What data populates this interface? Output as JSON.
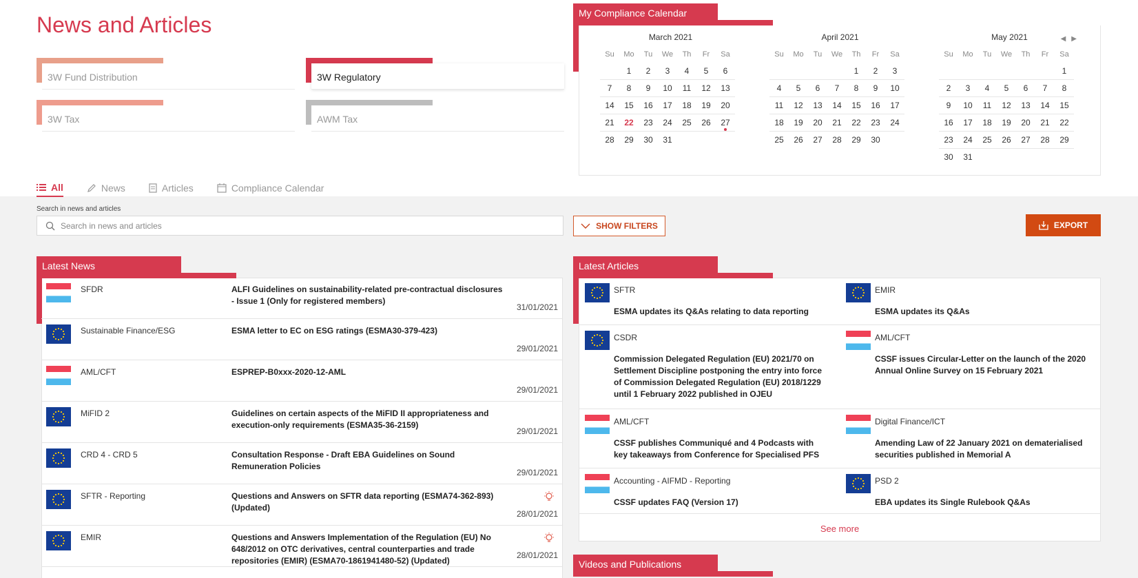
{
  "page": {
    "title": "News and Articles"
  },
  "categories": [
    {
      "label": "3W Fund Distribution",
      "color": "#e8a08a"
    },
    {
      "label": "3W Regulatory",
      "color": "#d63a4f"
    },
    {
      "label": "3W Tax",
      "color": "#ee9c8d"
    },
    {
      "label": "AWM Tax",
      "color": "#bdbdbd"
    }
  ],
  "tabs": [
    {
      "label": "All",
      "icon": "list-icon",
      "active": true
    },
    {
      "label": "News",
      "icon": "pencil-icon"
    },
    {
      "label": "Articles",
      "icon": "document-icon"
    },
    {
      "label": "Compliance Calendar",
      "icon": "calendar-icon"
    }
  ],
  "calendar": {
    "title": "My Compliance Calendar",
    "dow": [
      "Su",
      "Mo",
      "Tu",
      "We",
      "Th",
      "Fr",
      "Sa"
    ],
    "months": [
      {
        "name": "March 2021",
        "start": 1,
        "days": 31,
        "today": 22,
        "marked": [
          27
        ]
      },
      {
        "name": "April 2021",
        "start": 4,
        "days": 30,
        "today": null,
        "marked": []
      },
      {
        "name": "May 2021",
        "start": 6,
        "days": 31,
        "today": null,
        "marked": []
      }
    ]
  },
  "search": {
    "label": "Search in news and articles",
    "placeholder": "Search in news and articles"
  },
  "buttons": {
    "filters": "SHOW FILTERS",
    "export": "EXPORT"
  },
  "latest_news": {
    "title": "Latest News",
    "items": [
      {
        "flag": "lu",
        "category": "SFDR",
        "title": "ALFI Guidelines on sustainability-related pre-contractual disclosures - Issue 1 (Only for registered members)",
        "date": "31/01/2021",
        "bulb": false
      },
      {
        "flag": "eu",
        "category": "Sustainable Finance/ESG",
        "title": "ESMA letter to EC on ESG ratings (ESMA30-379-423)",
        "date": "29/01/2021",
        "bulb": false
      },
      {
        "flag": "lu",
        "category": "AML/CFT",
        "title": "ESPREP-B0xxx-2020-12-AML",
        "date": "29/01/2021",
        "bulb": false
      },
      {
        "flag": "eu",
        "category": "MiFID 2",
        "title": "Guidelines on certain aspects of the MiFID II appropriateness and execution-only requirements (ESMA35-36-2159)",
        "date": "29/01/2021",
        "bulb": false
      },
      {
        "flag": "eu",
        "category": "CRD 4 - CRD 5",
        "title": "Consultation Response - Draft EBA Guidelines on Sound Remuneration Policies",
        "date": "29/01/2021",
        "bulb": false
      },
      {
        "flag": "eu",
        "category": "SFTR - Reporting",
        "title": "Questions and Answers on SFTR data reporting (ESMA74-362-893) (Updated)",
        "date": "28/01/2021",
        "bulb": true
      },
      {
        "flag": "eu",
        "category": "EMIR",
        "title": "Questions and Answers Implementation of the Regulation (EU) No 648/2012 on OTC derivatives, central counterparties and trade repositories (EMIR) (ESMA70-1861941480-52) (Updated)",
        "date": "28/01/2021",
        "bulb": true
      }
    ]
  },
  "latest_articles": {
    "title": "Latest Articles",
    "see_more": "See more",
    "items": [
      {
        "flag": "eu",
        "category": "SFTR",
        "title": "ESMA updates its Q&As relating to data reporting"
      },
      {
        "flag": "eu",
        "category": "EMIR",
        "title": "ESMA updates its Q&As"
      },
      {
        "flag": "eu",
        "category": "CSDR",
        "title": "Commission Delegated Regulation (EU) 2021/70 on Settlement Discipline postponing the entry into force of Commission Delegated Regulation (EU) 2018/1229 until 1 February 2022 published in OJEU"
      },
      {
        "flag": "lu",
        "category": "AML/CFT",
        "title": "CSSF issues Circular-Letter on the launch of the 2020 Annual Online Survey on 15 February 2021"
      },
      {
        "flag": "lu",
        "category": "AML/CFT",
        "title": "CSSF publishes Communiqué and 4 Podcasts with key takeaways from Conference for Specialised PFS"
      },
      {
        "flag": "lu",
        "category": "Digital Finance/ICT",
        "title": "Amending Law of 22 January 2021 on dematerialised securities published in Memorial A"
      },
      {
        "flag": "lu",
        "category": "Accounting - AIFMD - Reporting",
        "title": "CSSF updates FAQ (Version 17)"
      },
      {
        "flag": "eu",
        "category": "PSD 2",
        "title": "EBA updates its Single Rulebook Q&As"
      }
    ]
  },
  "videos": {
    "title": "Videos and Publications"
  }
}
